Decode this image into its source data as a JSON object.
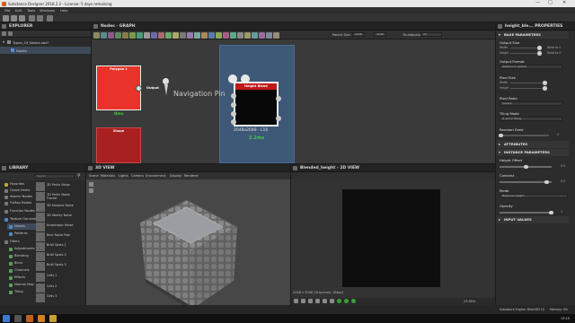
{
  "app": {
    "title": "Substance Designer 2018.2.2 - License: 5 days remaining",
    "menu": [
      "File",
      "Edit",
      "Tools",
      "Windows",
      "Help"
    ]
  },
  "explorer": {
    "title": "EXPLORER",
    "package": "Types_Of_Nodes.sbs*",
    "graph": "Nodes"
  },
  "graph": {
    "title": "Nodes - GRAPH",
    "parent_size_label": "Parent Size:",
    "parent_size": "2048",
    "size2": "2048",
    "thumbnails_label": "Thumbnails:",
    "thumbnails": "All",
    "nodes": {
      "polygon": {
        "title": "Polygon 1",
        "time": "0ms",
        "output_label": "Output"
      },
      "shape": {
        "title": "Shape"
      },
      "blend": {
        "title": "Height Blend",
        "info": "2048x2048 - L16",
        "time": "2.2ms"
      }
    },
    "pin_label": "Navigation Pin"
  },
  "view3d": {
    "title": "3D VIEW",
    "menu": [
      "Scene",
      "Materials",
      "Lights",
      "Camera",
      "Environment",
      "Display",
      "Renderer"
    ]
  },
  "view2d": {
    "title": "Blended_height - 2D VIEW",
    "status": "2048 x 2048 (Grayscale, 16bpc)",
    "zoom": "23.05%"
  },
  "library": {
    "title": "LIBRARY",
    "search_placeholder": "Search",
    "categories": [
      {
        "label": "Favorites",
        "color": "#c8a030"
      },
      {
        "label": "Graph Items",
        "color": "#7a7a7a"
      },
      {
        "label": "Atomic Nodes",
        "color": "#7a7a7a"
      },
      {
        "label": "FxMap Nodes",
        "color": "#7a7a7a"
      },
      {
        "label": "Function Nodes",
        "color": "#7a7a7a"
      },
      {
        "label": "Texture Generators",
        "color": "#4a8ac8"
      },
      {
        "label": "Noises",
        "color": "#4a8ac8"
      },
      {
        "label": "Patterns",
        "color": "#4a8ac8"
      },
      {
        "label": "Filters",
        "color": "#7a7a7a"
      },
      {
        "label": "Adjustments",
        "color": "#5aa05a"
      },
      {
        "label": "Blending",
        "color": "#5aa05a"
      },
      {
        "label": "Blurs",
        "color": "#5aa05a"
      },
      {
        "label": "Channels",
        "color": "#5aa05a"
      },
      {
        "label": "Effects",
        "color": "#5aa05a"
      },
      {
        "label": "Normal Map",
        "color": "#5aa05a"
      },
      {
        "label": "Tiling",
        "color": "#5aa05a"
      }
    ],
    "items": [
      {
        "label": "3D Perlin Noise"
      },
      {
        "label": "3D Perlin Noise Fractal"
      },
      {
        "label": "3D Simplex Noise"
      },
      {
        "label": "3D Worley Noise"
      },
      {
        "label": "Anisotropic Noise"
      },
      {
        "label": "Blue Noise Fast"
      },
      {
        "label": "BnW Spots 1"
      },
      {
        "label": "BnW Spots 2"
      },
      {
        "label": "BnW Spots 3"
      },
      {
        "label": "Cells 1"
      },
      {
        "label": "Cells 2"
      },
      {
        "label": "Cells 3"
      }
    ]
  },
  "properties": {
    "title": "height_ble... PROPERTIES",
    "sections": {
      "base": "BASE PARAMETERS",
      "attributes": "ATTRIBUTES",
      "instance": "INSTANCE PARAMETERS",
      "input": "INPUT VALUES"
    },
    "output_size": {
      "label": "Output Size",
      "width_label": "Width",
      "height_label": "Height",
      "width_val": "Relat to 0",
      "height_val": "Relat to 0"
    },
    "output_format": {
      "label": "Output Format",
      "value": "Relative to parent"
    },
    "pixel_size": {
      "label": "Pixel Size",
      "width_label": "Width",
      "height_label": "Height"
    },
    "pixel_ratio": {
      "label": "Pixel Ratio",
      "value": "Square"
    },
    "tiling_mode": {
      "label": "Tiling Mode",
      "value": "H and V Tiling"
    },
    "random_seed": {
      "label": "Random Seed",
      "value": "0"
    },
    "height_offset": {
      "label": "Height Offset",
      "value": "0.5",
      "fraction": 0.5
    },
    "contrast": {
      "label": "Contrast",
      "value": "0.9",
      "fraction": 0.9
    },
    "mode": {
      "label": "Mode",
      "value": "Balanced height"
    },
    "opacity": {
      "label": "Opacity",
      "value": "1",
      "fraction": 1.0
    }
  },
  "statusbar": {
    "engine": "Substance Engine: Direct3D 10",
    "memory": "Memory: 0%",
    "time": "13:15"
  }
}
